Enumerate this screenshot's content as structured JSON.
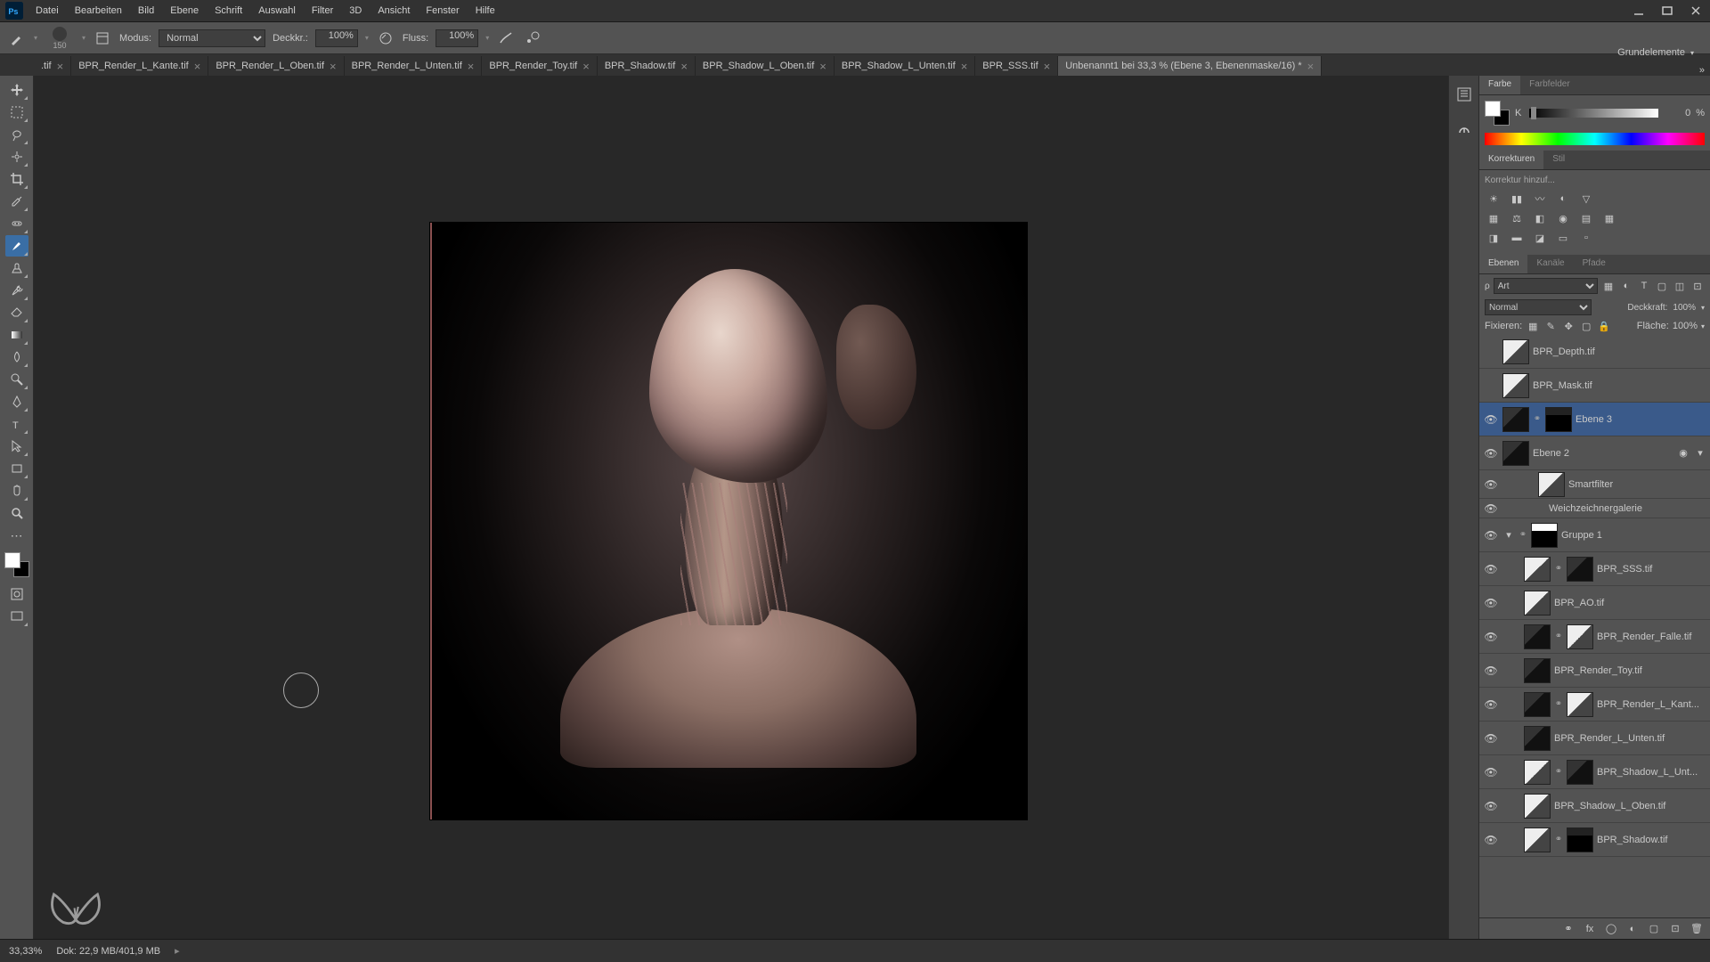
{
  "menus": [
    "Datei",
    "Bearbeiten",
    "Bild",
    "Ebene",
    "Schrift",
    "Auswahl",
    "Filter",
    "3D",
    "Ansicht",
    "Fenster",
    "Hilfe"
  ],
  "optbar": {
    "brush_size": "150",
    "mode_label": "Modus:",
    "mode_value": "Normal",
    "opacity_label": "Deckkr.:",
    "opacity_value": "100%",
    "flow_label": "Fluss:",
    "flow_value": "100%"
  },
  "workspace_label": "Grundelemente",
  "tabs": [
    {
      "label": ".tif",
      "active": false
    },
    {
      "label": "BPR_Render_L_Kante.tif",
      "active": false
    },
    {
      "label": "BPR_Render_L_Oben.tif",
      "active": false
    },
    {
      "label": "BPR_Render_L_Unten.tif",
      "active": false
    },
    {
      "label": "BPR_Render_Toy.tif",
      "active": false
    },
    {
      "label": "BPR_Shadow.tif",
      "active": false
    },
    {
      "label": "BPR_Shadow_L_Oben.tif",
      "active": false
    },
    {
      "label": "BPR_Shadow_L_Unten.tif",
      "active": false
    },
    {
      "label": "BPR_SSS.tif",
      "active": false
    },
    {
      "label": "Unbenannt1 bei 33,3 % (Ebene 3, Ebenenmaske/16) *",
      "active": true
    }
  ],
  "color_panel": {
    "tab1": "Farbe",
    "tab2": "Farbfelder",
    "channel": "K",
    "value": "0",
    "pct": "%"
  },
  "adjust_panel": {
    "tab1": "Korrekturen",
    "tab2": "Stil",
    "hint": "Korrektur hinzuf..."
  },
  "layers_panel": {
    "tab1": "Ebenen",
    "tab2": "Kanäle",
    "tab3": "Pfade",
    "filter_label": "Art",
    "blend_value": "Normal",
    "opacity_label": "Deckkraft:",
    "opacity_value": "100%",
    "lock_label": "Fixieren:",
    "fill_label": "Fläche:",
    "fill_value": "100%"
  },
  "layers": [
    {
      "vis": false,
      "indent": 0,
      "thumbs": [
        "light"
      ],
      "name": "BPR_Depth.tif"
    },
    {
      "vis": false,
      "indent": 0,
      "thumbs": [
        "light"
      ],
      "name": "BPR_Mask.tif"
    },
    {
      "vis": true,
      "indent": 0,
      "thumbs": [
        "dark",
        "link",
        "maskdark"
      ],
      "name": "Ebene 3",
      "selected": true
    },
    {
      "vis": true,
      "indent": 0,
      "thumbs": [
        "dark"
      ],
      "name": "Ebene 2",
      "fold": true,
      "smart": true
    },
    {
      "vis": true,
      "indent": 36,
      "thumbs": [
        "light"
      ],
      "name": "Smartfilter",
      "sub": true
    },
    {
      "vis": true,
      "indent": 48,
      "thumbs": [],
      "name": "Weichzeichnergalerie",
      "text": true
    },
    {
      "vis": true,
      "indent": 0,
      "thumbs": [
        "fold",
        "link",
        "mask"
      ],
      "name": "Gruppe 1",
      "group": true
    },
    {
      "vis": true,
      "indent": 20,
      "thumbs": [
        "light",
        "link",
        "dark"
      ],
      "name": "BPR_SSS.tif"
    },
    {
      "vis": true,
      "indent": 20,
      "thumbs": [
        "light"
      ],
      "name": "BPR_AO.tif"
    },
    {
      "vis": true,
      "indent": 20,
      "thumbs": [
        "dark",
        "link",
        "light"
      ],
      "name": "BPR_Render_Falle.tif"
    },
    {
      "vis": true,
      "indent": 20,
      "thumbs": [
        "dark"
      ],
      "name": "BPR_Render_Toy.tif"
    },
    {
      "vis": true,
      "indent": 20,
      "thumbs": [
        "dark",
        "link",
        "light"
      ],
      "name": "BPR_Render_L_Kant..."
    },
    {
      "vis": true,
      "indent": 20,
      "thumbs": [
        "dark"
      ],
      "name": "BPR_Render_L_Unten.tif"
    },
    {
      "vis": true,
      "indent": 20,
      "thumbs": [
        "light",
        "link",
        "dark"
      ],
      "name": "BPR_Shadow_L_Unt..."
    },
    {
      "vis": true,
      "indent": 20,
      "thumbs": [
        "light"
      ],
      "name": "BPR_Shadow_L_Oben.tif"
    },
    {
      "vis": true,
      "indent": 20,
      "thumbs": [
        "light",
        "link",
        "maskdark"
      ],
      "name": "BPR_Shadow.tif"
    }
  ],
  "status": {
    "zoom": "33,33%",
    "doc": "Dok: 22,9 MB/401,9 MB"
  }
}
